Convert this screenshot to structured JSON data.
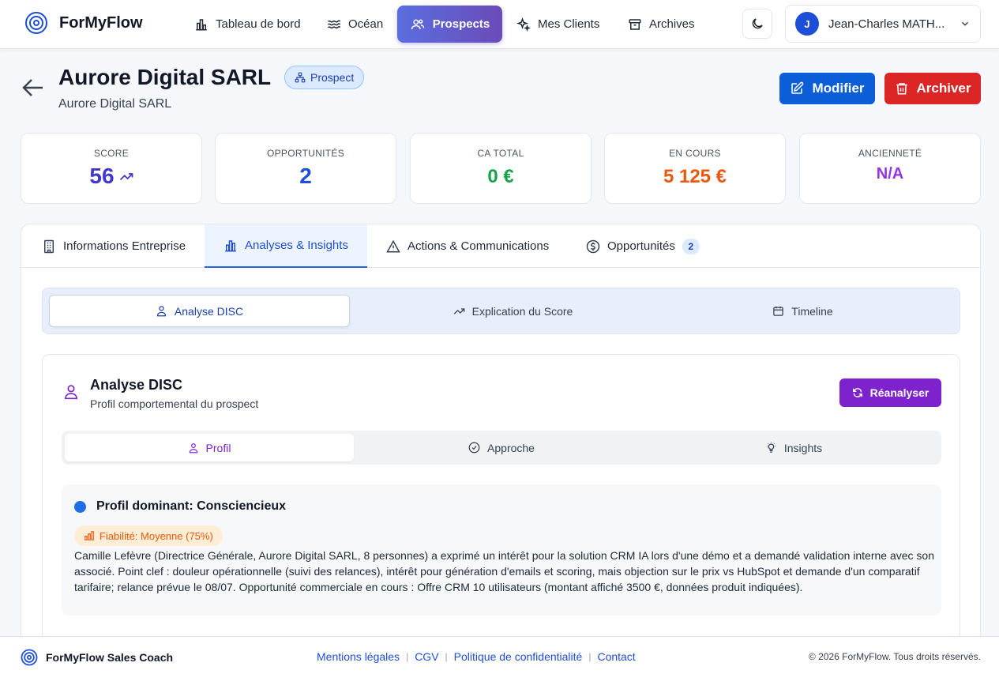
{
  "brand": {
    "name": "ForMyFlow"
  },
  "nav": {
    "items": [
      {
        "label": "Tableau de bord",
        "icon": "bar-chart-icon"
      },
      {
        "label": "Océan",
        "icon": "waves-icon"
      },
      {
        "label": "Prospects",
        "icon": "users-icon",
        "active": true
      },
      {
        "label": "Mes Clients",
        "icon": "sparkles-icon"
      },
      {
        "label": "Archives",
        "icon": "archive-icon"
      }
    ],
    "user": {
      "initial": "J",
      "name": "Jean-Charles MATH..."
    }
  },
  "header": {
    "title": "Aurore Digital SARL",
    "badge": "Prospect",
    "subtitle": "Aurore Digital SARL",
    "edit_label": "Modifier",
    "archive_label": "Archiver"
  },
  "stats": [
    {
      "label": "SCORE",
      "value": "56",
      "color": "#4338ca"
    },
    {
      "label": "OPPORTUNITÉS",
      "value": "2",
      "color": "#1d4ed8"
    },
    {
      "label": "CA TOTAL",
      "value": "0 €",
      "color": "#16a34a"
    },
    {
      "label": "EN COURS",
      "value": "5 125 €",
      "color": "#ea580c"
    },
    {
      "label": "ANCIENNETÉ",
      "value": "N/A",
      "color": "#9333ea"
    }
  ],
  "tabs": [
    {
      "label": "Informations Entreprise"
    },
    {
      "label": "Analyses & Insights",
      "active": true
    },
    {
      "label": "Actions & Communications"
    },
    {
      "label": "Opportunités",
      "count": "2"
    }
  ],
  "subtabs": [
    {
      "label": "Analyse DISC",
      "active": true
    },
    {
      "label": "Explication du Score"
    },
    {
      "label": "Timeline"
    }
  ],
  "disc": {
    "title": "Analyse DISC",
    "subtitle": "Profil comportemental du prospect",
    "reanalyse_label": "Réanalyser",
    "inner_tabs": [
      {
        "label": "Profil",
        "active": true
      },
      {
        "label": "Approche"
      },
      {
        "label": "Insights"
      }
    ],
    "profile": {
      "title": "Profil dominant: Consciencieux",
      "reliability": "Fiabilité: Moyenne (75%)",
      "text": "Camille Lefèvre (Directrice Générale, Aurore Digital SARL, 8 personnes) a exprimé un intérêt pour la solution CRM IA lors d'une démo et a demandé validation interne avec son associé. Point clef : douleur opérationnelle (suivi des relances), intérêt pour génération d'emails et scoring, mais objection sur le prix vs HubSpot et demande d'un comparatif tarifaire; relance prévue le 08/07. Opportunité commerciale en cours : Offre CRM 10 utilisateurs (montant affiché 3500 €, données produit indiquées)."
    }
  },
  "footer": {
    "brand": "ForMyFlow Sales Coach",
    "links": [
      "Mentions légales",
      "CGV",
      "Politique de confidentialité",
      "Contact"
    ],
    "copyright": "© 2026 ForMyFlow. Tous droits réservés."
  }
}
